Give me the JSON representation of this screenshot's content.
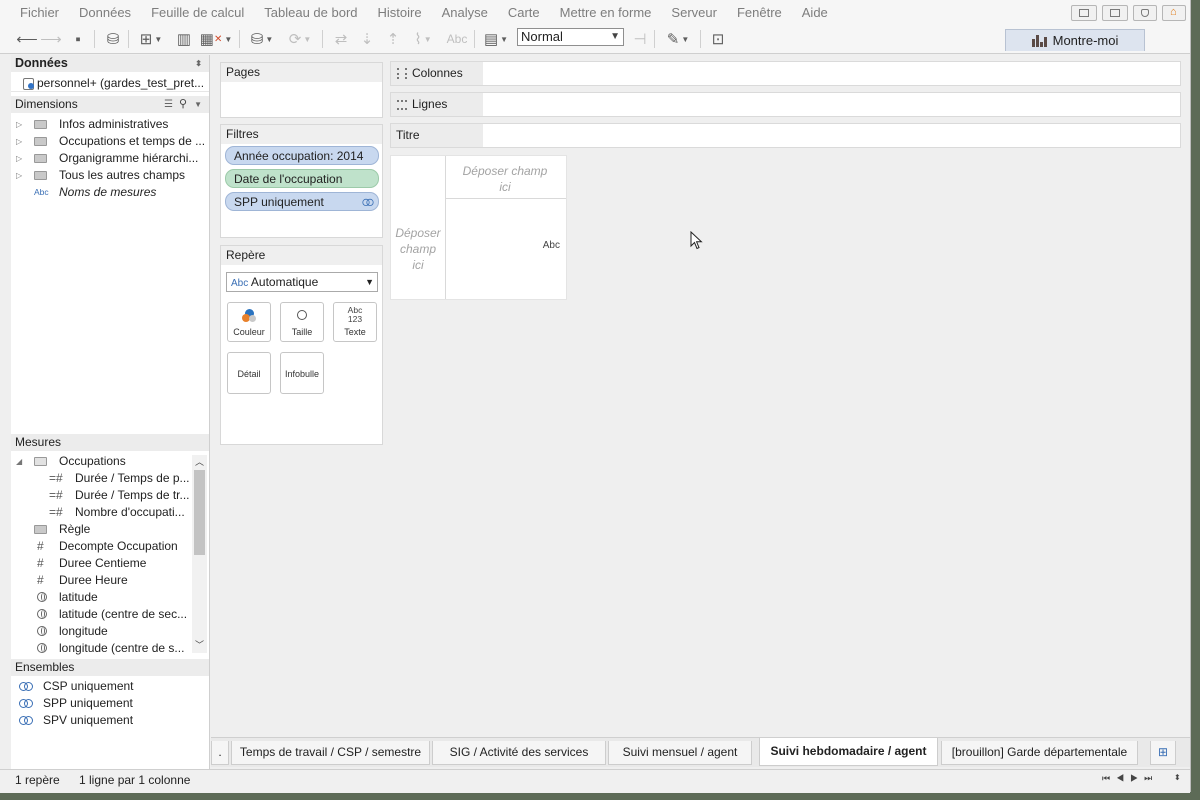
{
  "menu": [
    "Fichier",
    "Données",
    "Feuille de calcul",
    "Tableau de bord",
    "Histoire",
    "Analyse",
    "Carte",
    "Mettre en forme",
    "Serveur",
    "Fenêtre",
    "Aide"
  ],
  "toolbar": {
    "size_select": "Normal",
    "show_me": "Montre-moi",
    "abc_label": "Abc"
  },
  "data_pane": {
    "title": "Données",
    "datasource": "personnel+ (gardes_test_pret...",
    "dimensions_title": "Dimensions",
    "dimensions": [
      "Infos administratives",
      "Occupations et temps de ...",
      "Organigramme hiérarchi...",
      "Tous les autres champs"
    ],
    "abc_icon": "Abc",
    "measure_names": "Noms de mesures",
    "measures_title": "Mesures",
    "measures_folder": "Occupations",
    "measures_sub": [
      "Durée / Temps de p...",
      "Durée / Temps de tr...",
      "Nombre d'occupati..."
    ],
    "measures_rule": "Règle",
    "measures": [
      "Decompte Occupation",
      "Duree Centieme",
      "Duree Heure"
    ],
    "geo": [
      "latitude",
      "latitude (centre de sec...",
      "longitude",
      "longitude (centre de s..."
    ],
    "sets_title": "Ensembles",
    "sets": [
      "CSP uniquement",
      "SPP uniquement",
      "SPV uniquement"
    ]
  },
  "cards": {
    "pages": "Pages",
    "filters": "Filtres",
    "filter_pills": [
      "Année occupation: 2014",
      "Date de l'occupation",
      "SPP uniquement"
    ],
    "marks": "Repère",
    "mark_type": "Automatique",
    "mark_buttons": [
      "Couleur",
      "Taille",
      "Texte",
      "Détail",
      "Infobulle"
    ],
    "text_icon": [
      "Abc",
      "123"
    ]
  },
  "shelves": {
    "columns": "Colonnes",
    "rows": "Lignes",
    "title": "Titre"
  },
  "viz": {
    "drop_top": [
      "Déposer champ",
      "ici"
    ],
    "drop_left": [
      "Déposer",
      "champ",
      "ici"
    ],
    "cell": "Abc"
  },
  "tabs": {
    "partial": ".",
    "items": [
      "Temps de travail / CSP / semestre",
      "SIG / Activité des services",
      "Suivi mensuel / agent",
      "Suivi hebdomadaire / agent",
      "[brouillon] Garde départementale"
    ],
    "active_index": 3
  },
  "status": {
    "marks": "1 repère",
    "layout": "1 ligne par 1 colonne"
  }
}
